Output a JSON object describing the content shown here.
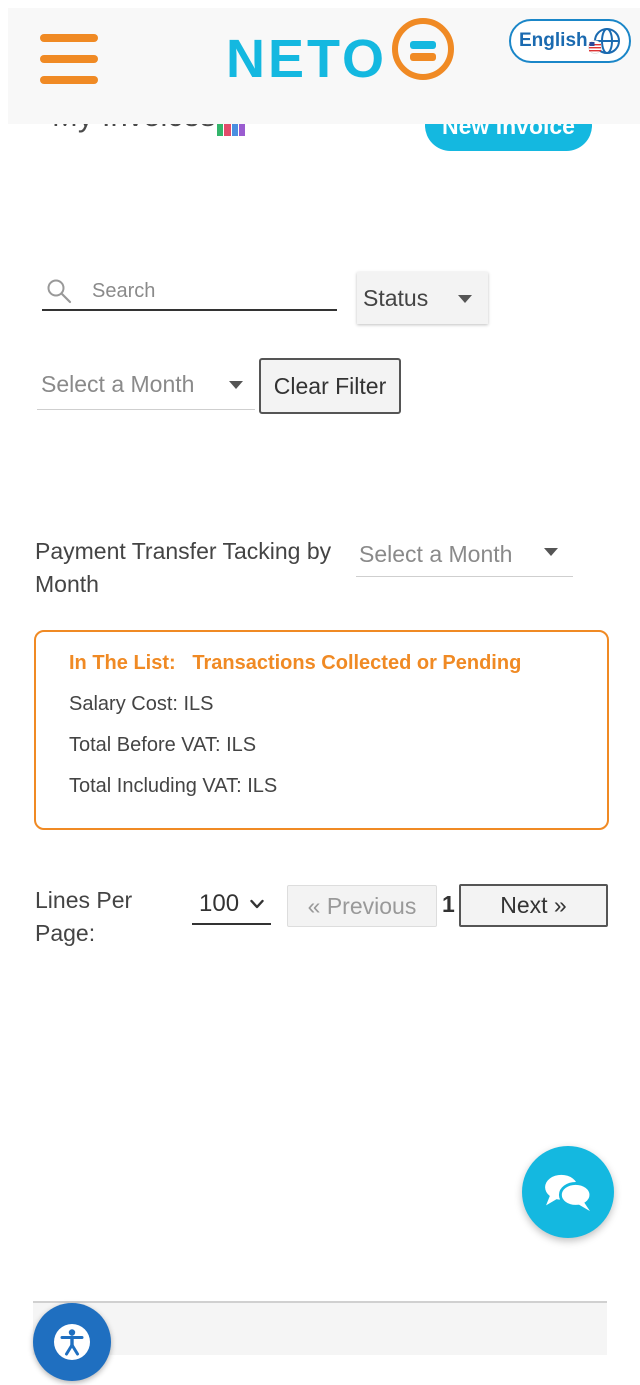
{
  "header": {
    "logo_text": "NETO",
    "language_label": "English"
  },
  "page": {
    "title": "My Invoices",
    "new_invoice_label": "New Invoice"
  },
  "filters": {
    "search_placeholder": "Search",
    "status_label": "Status",
    "month_placeholder": "Select a Month",
    "clear_filter_label": "Clear Filter"
  },
  "payment_tracking": {
    "label": "Payment Transfer Tacking by Month",
    "month_placeholder": "Select a Month"
  },
  "summary": {
    "heading_prefix": "In The List:",
    "heading_value": "Transactions Collected or Pending",
    "salary_cost": "Salary Cost: ILS",
    "total_before_vat": "Total Before VAT: ILS",
    "total_including_vat": "Total Including VAT: ILS"
  },
  "pagination": {
    "lines_per_page_label": "Lines Per Page:",
    "lines_per_page_value": "100",
    "previous_label": "« Previous",
    "current_page": "1",
    "next_label": "Next »"
  },
  "colors": {
    "brand_blue": "#14b8e0",
    "brand_orange": "#f08a24",
    "accessibility_blue": "#1f6fc0"
  },
  "icons": [
    "menu-icon",
    "globe-icon",
    "us-flag-icon",
    "search-icon",
    "chevron-down-icon",
    "chat-icon",
    "accessibility-icon"
  ]
}
